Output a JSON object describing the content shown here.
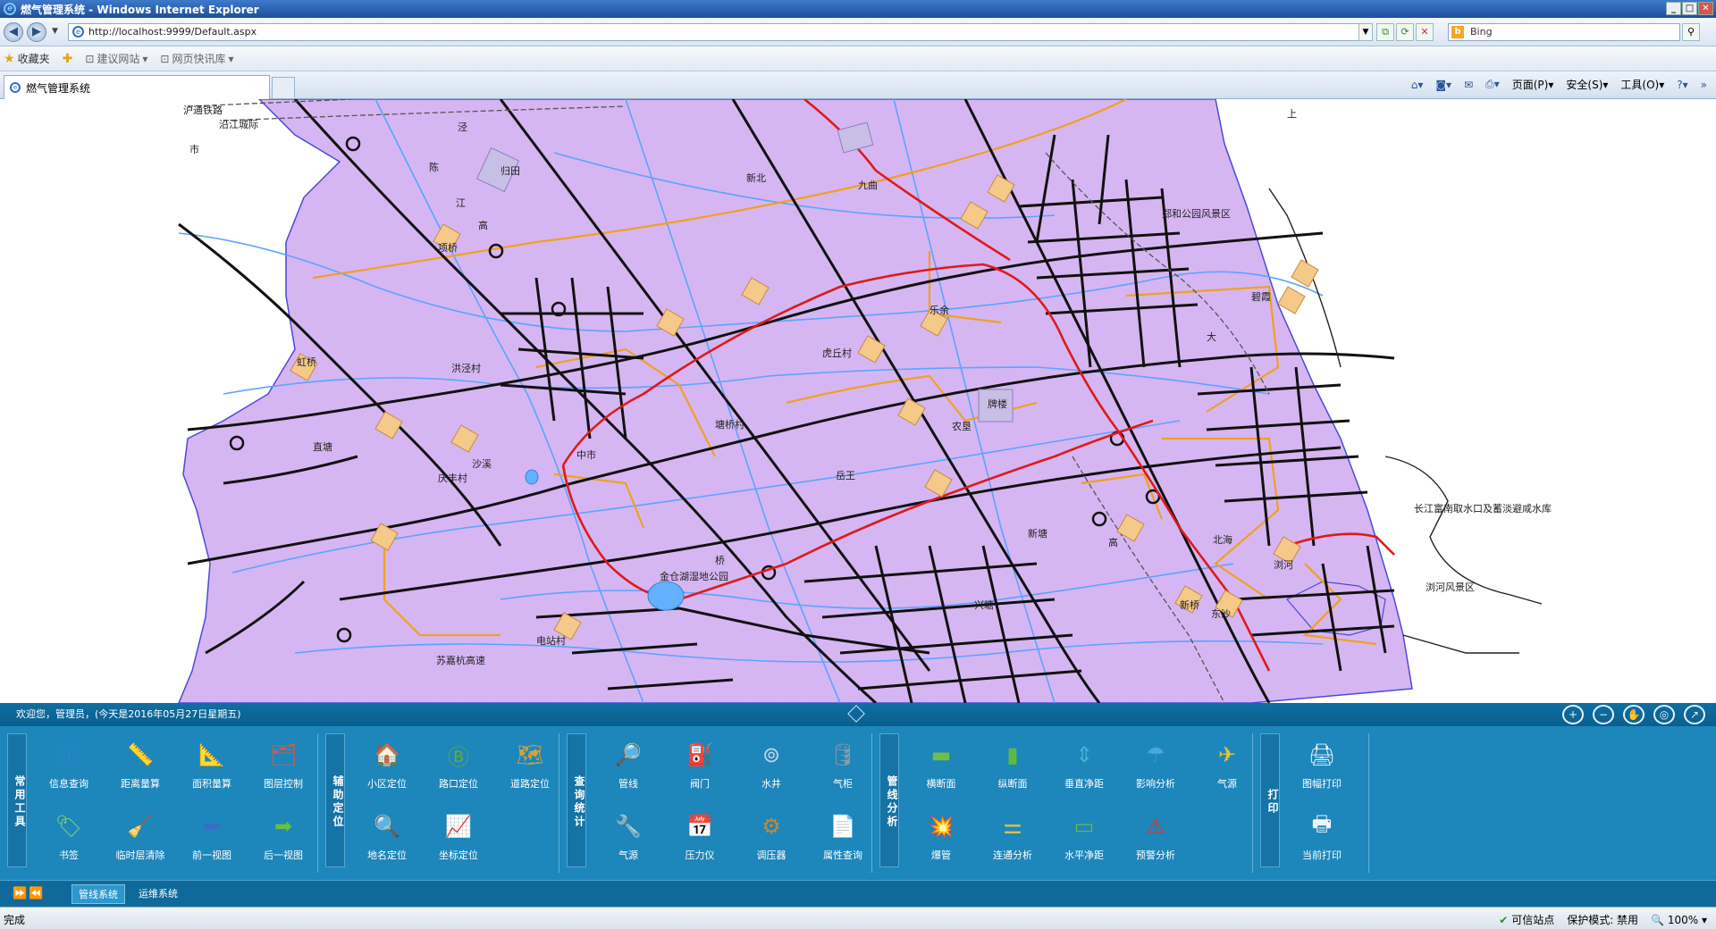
{
  "window": {
    "title": "燃气管理系统 - Windows Internet Explorer",
    "minimize": "_",
    "maximize": "□",
    "close": "✕"
  },
  "address": {
    "url": "http://localhost:9999/Default.aspx",
    "search_placeholder": "Bing"
  },
  "favorites": {
    "label": "收藏夹",
    "items": [
      "建议网站",
      "网页快讯库"
    ]
  },
  "tab": {
    "title": "燃气管理系统"
  },
  "commands": {
    "page": "页面(P)",
    "safety": "安全(S)",
    "tools": "工具(O)"
  },
  "panel": {
    "welcome": "欢迎您，管理员，(今天是2016年05月27日星期五)",
    "groups": [
      {
        "label": "常用工具",
        "tools": [
          "信息查询",
          "距离量算",
          "面积量算",
          "图层控制",
          "书签",
          "临时层清除",
          "前一视图",
          "后一视图"
        ]
      },
      {
        "label": "辅助定位",
        "tools": [
          "小区定位",
          "路口定位",
          "道路定位",
          "地名定位",
          "坐标定位"
        ]
      },
      {
        "label": "查询统计",
        "tools": [
          "管线",
          "阀门",
          "水井",
          "气柜",
          "气源",
          "压力仪",
          "调压器",
          "属性查询"
        ]
      },
      {
        "label": "管线分析",
        "tools": [
          "横断面",
          "纵断面",
          "垂直净距",
          "影响分析",
          "气源",
          "爆管",
          "连通分析",
          "水平净距",
          "预警分析"
        ]
      },
      {
        "label": "打印",
        "tools": [
          "图幅打印",
          "当前打印"
        ]
      }
    ],
    "bottom_tabs": [
      "管线系统",
      "运维系统"
    ]
  },
  "map_labels": {
    "l1": "沪通铁路",
    "l2": "沿江城际",
    "l3": "市",
    "l4": "泾",
    "l5": "归田",
    "l6": "陈",
    "l7": "江",
    "l8": "项桥",
    "l9": "高",
    "l10": "新北",
    "l11": "九曲",
    "l12": "郑和公园风景区",
    "l13": "碧霞",
    "l14": "乐余",
    "l15": "庆丰村",
    "l16": "洪泾村",
    "l17": "虹桥",
    "l18": "直塘",
    "l19": "中市",
    "l20": "沙溪",
    "l21": "塘桥村",
    "l22": "虎丘村",
    "l23": "农垦",
    "l24": "岳王",
    "l25": "新塘",
    "l26": "金仓湖湿地公园",
    "l27": "电站村",
    "l28": "苏嘉杭高速",
    "l29": "长江富南取水口及蓄淡避咸水库",
    "l30": "浏河风景区",
    "l31": "北海",
    "l32": "东沙",
    "l33": "高",
    "l34": "兴塘",
    "l35": "桥",
    "l36": "大",
    "l37": "浏河",
    "l38": "牌楼",
    "l39": "新桥",
    "l40": "上"
  },
  "status": {
    "done": "完成",
    "trusted": "可信站点",
    "protect": "保护模式: 禁用",
    "zoom": "100%"
  },
  "colors": {
    "map_fill": "#d6b6f2",
    "road_black": "#111111",
    "road_orange": "#f0a020",
    "water": "#5aa3ff",
    "rail": "#555555",
    "main_red": "#dd1a1a",
    "panel": "#1d86bb"
  }
}
